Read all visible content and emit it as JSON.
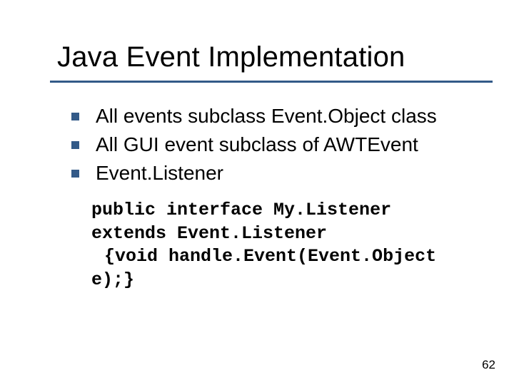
{
  "title": "Java Event Implementation",
  "bullets": [
    "All events subclass Event.Object class",
    "All GUI event subclass of AWTEvent",
    "Event.Listener"
  ],
  "code": {
    "l1": "public interface My.Listener",
    "l2": "extends Event.Listener",
    "l3": "{void handle.Event(Event.Object",
    "l4": "e);}"
  },
  "page_number": "62"
}
